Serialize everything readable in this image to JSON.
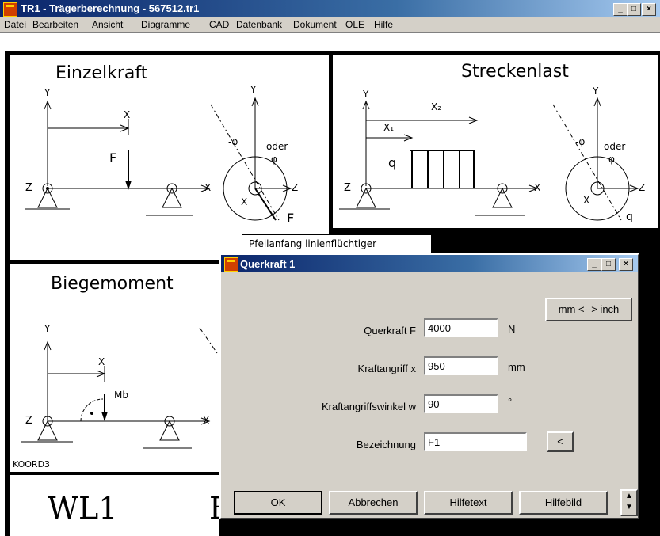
{
  "window": {
    "title": "TR1  -  Trägerberechnung  -  567512.tr1",
    "min": "_",
    "max": "□",
    "close": "×"
  },
  "menu": [
    "Datei",
    "Bearbeiten",
    "Ansicht",
    "Diagramme",
    "CAD",
    "Datenbank",
    "Dokument",
    "OLE",
    "Hilfe"
  ],
  "panels": {
    "einzelkraft": {
      "title": "Einzelkraft",
      "y": "Y",
      "x": "X",
      "z": "Z",
      "f": "F",
      "phi": "-φ",
      "oder": "oder",
      "phi2": "φ",
      "x2": "X",
      "z2": "Z"
    },
    "streckenlast": {
      "title": "Streckenlast",
      "y": "Y",
      "x1": "X₁",
      "x2": "X₂",
      "q": "q",
      "x": "X",
      "z": "Z",
      "phi": "-φ",
      "oder": "oder",
      "phi2": "φ",
      "x3": "X",
      "z2": "Z"
    },
    "biegemoment": {
      "title": "Biegemoment",
      "y": "Y",
      "x": "X",
      "mb": "Mb",
      "z": "Z",
      "x2": "X",
      "koord": "KOORD3"
    },
    "bottom": {
      "text": "WL1",
      "partial": "E"
    }
  },
  "tooltip": "Pfeilanfang linienflüchtiger",
  "dialog": {
    "title": "Querkraft 1",
    "unit_toggle": "mm <--> inch",
    "fields": [
      {
        "label": "Querkraft F",
        "value": "4000",
        "unit": "N"
      },
      {
        "label": "Kraftangriff x",
        "value": "950",
        "unit": "mm"
      },
      {
        "label": "Kraftangriffswinkel w",
        "value": "90",
        "unit": "°"
      },
      {
        "label": "Bezeichnung",
        "value": "F1",
        "unit": ""
      }
    ],
    "pick_button": "<",
    "buttons": {
      "ok": "OK",
      "cancel": "Abbrechen",
      "helptext": "Hilfetext",
      "helpimage": "Hilfebild"
    }
  }
}
